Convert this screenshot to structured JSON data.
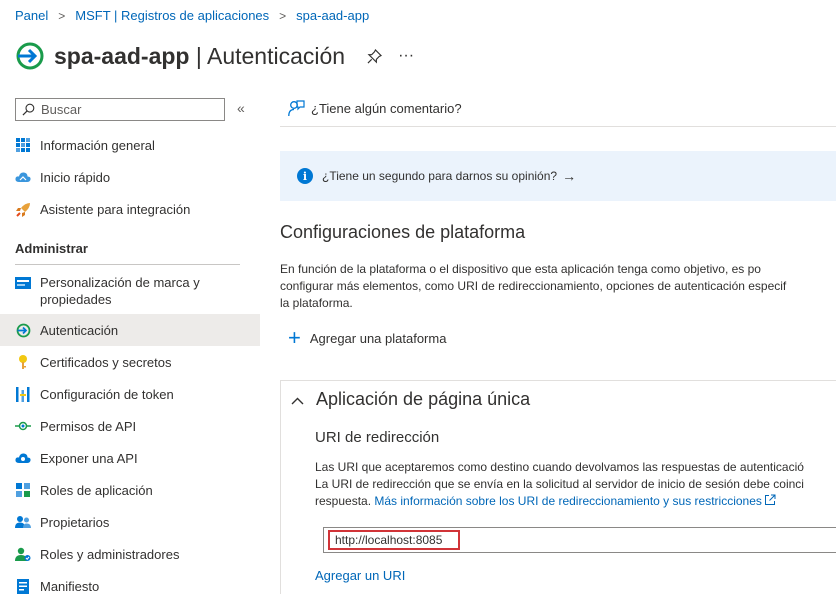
{
  "breadcrumb": {
    "items": [
      "Panel",
      "MSFT | Registros de aplicaciones",
      "spa-aad-app"
    ],
    "separator": ">"
  },
  "header": {
    "app_name": "spa-aad-app",
    "separator": "|",
    "page": "Autenticación",
    "pin_icon": "pin-icon",
    "more_label": "···"
  },
  "sidebar": {
    "search_placeholder": "Buscar",
    "collapse_label": "«",
    "items_top": [
      {
        "label": "Información general",
        "icon": "overview-grid-icon"
      },
      {
        "label": "Inicio rápido",
        "icon": "cloud-quickstart-icon"
      },
      {
        "label": "Asistente para integración",
        "icon": "rocket-icon"
      }
    ],
    "section": "Administrar",
    "items_manage": [
      {
        "label": "Personalización de marca y",
        "label2": "propiedades",
        "icon": "branding-icon"
      },
      {
        "label": "Autenticación",
        "icon": "authentication-icon",
        "active": true
      },
      {
        "label": "Certificados y secretos",
        "icon": "key-icon"
      },
      {
        "label": "Configuración de token",
        "icon": "token-bars-icon"
      },
      {
        "label": "Permisos de API",
        "icon": "api-permissions-icon"
      },
      {
        "label": "Exponer una API",
        "icon": "expose-api-cloud-icon"
      },
      {
        "label": "Roles de aplicación",
        "icon": "app-roles-grid-icon"
      },
      {
        "label": "Propietarios",
        "icon": "owners-people-icon"
      },
      {
        "label": "Roles y administradores",
        "icon": "roles-admins-icon"
      },
      {
        "label": "Manifiesto",
        "icon": "manifest-icon"
      }
    ]
  },
  "main": {
    "feedback_label": "¿Tiene algún comentario?",
    "info_bar": {
      "text": "¿Tiene un segundo para darnos su opinión?",
      "arrow": "→"
    },
    "section_title": "Configuraciones de plataforma",
    "section_desc": [
      "En función de la plataforma o el dispositivo que esta aplicación tenga como objetivo, es po",
      "configurar más elementos, como URI de redireccionamiento, opciones de autenticación especif",
      "la plataforma."
    ],
    "add_platform": "Agregar una plataforma",
    "card": {
      "title": "Aplicación de página única",
      "uri_title": "URI de redirección",
      "uri_desc_1": "Las URI que aceptaremos como destino cuando devolvamos las respuestas de autenticació",
      "uri_desc_2": "La URI de redirección que se envía en la solicitud al servidor de inicio de sesión debe coinci",
      "uri_desc_3": "respuesta.",
      "uri_link": "Más información sobre los URI de redireccionamiento y sus restricciones",
      "uri_value": "http://localhost:8085",
      "add_uri": "Agregar un URI"
    }
  },
  "colors": {
    "link": "#0067b8",
    "accent": "#0078d4",
    "active_bg": "#edebe9",
    "info_bg": "#ebf3fc",
    "highlight_border": "#d13438"
  }
}
